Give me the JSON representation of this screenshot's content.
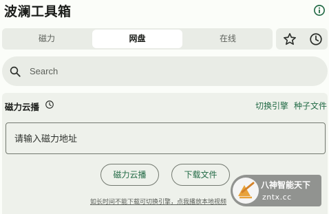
{
  "app": {
    "title": "波澜工具箱"
  },
  "tabs": [
    {
      "label": "磁力",
      "selected": false
    },
    {
      "label": "网盘",
      "selected": true
    },
    {
      "label": "在线",
      "selected": false
    }
  ],
  "toolbar": {
    "favorites_icon": "star-icon",
    "history_icon": "clock-icon",
    "info_icon": "info-icon"
  },
  "search": {
    "placeholder": "Search",
    "value": ""
  },
  "magnet_panel": {
    "title": "磁力云播",
    "history_icon": "clock-icon",
    "switch_engine_label": "切换引擎",
    "seed_file_label": "种子文件",
    "input_placeholder": "请输入磁力地址",
    "input_value": "",
    "play_button": "磁力云播",
    "download_button": "下载文件",
    "hint": "如长时间不能下载可切换引擎，点我播放本地视频"
  },
  "watermark": {
    "line1": "八神智能天下",
    "line2": "zntx.cc"
  },
  "colors": {
    "accent": "#226a45",
    "surface": "#e9ece6",
    "background": "#fbfdf9"
  }
}
